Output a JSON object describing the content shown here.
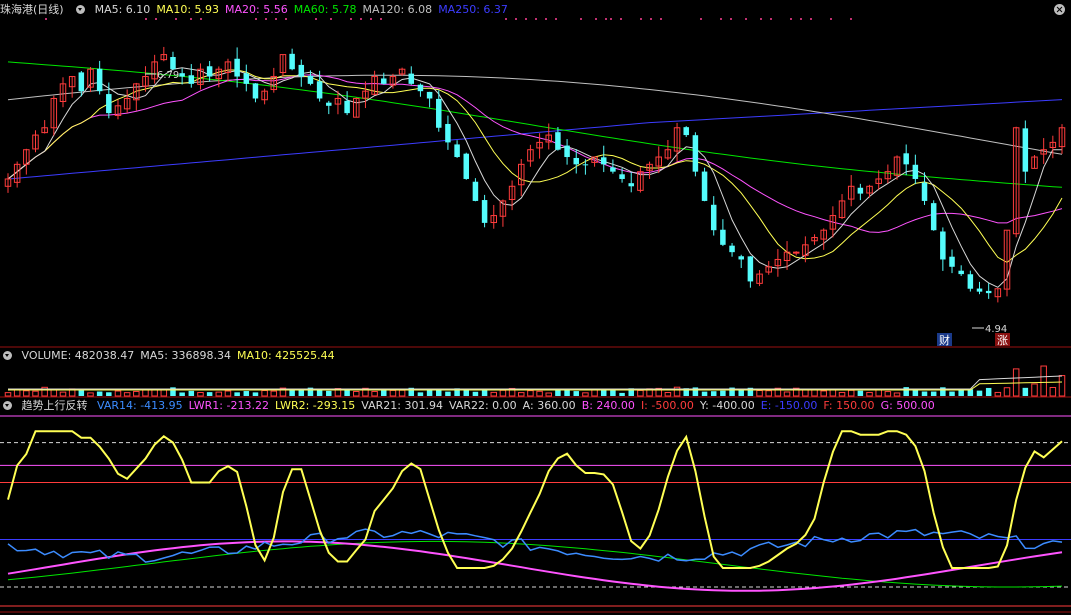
{
  "colors": {
    "bg": "#000000",
    "up": "#ff3c3c",
    "down": "#54fcfc",
    "ma5": "#d8d8d8",
    "ma10": "#ffff54",
    "ma20": "#ff54ff",
    "ma60": "#00e600",
    "ma120": "#c0c0c0",
    "ma250": "#3c3cff",
    "sep": "#9a1010"
  },
  "price_panel": {
    "title": "珠海港(日线)",
    "ma": [
      {
        "label": "MA5: 6.10",
        "color": "#d8d8d8"
      },
      {
        "label": "MA10: 5.93",
        "color": "#ffff54"
      },
      {
        "label": "MA20: 5.56",
        "color": "#ff54ff"
      },
      {
        "label": "MA60: 5.78",
        "color": "#00e600"
      },
      {
        "label": "MA120: 6.08",
        "color": "#c0c0c0"
      },
      {
        "label": "MA250: 6.37",
        "color": "#3c3cff"
      }
    ],
    "high_label": "6.79",
    "low_label": "4.94",
    "badge_cai": "财",
    "badge_zhang": "涨"
  },
  "volume_panel": {
    "items": [
      {
        "label": "VOLUME: 482038.47",
        "color": "#d8d8d8"
      },
      {
        "label": "MA5: 336898.34",
        "color": "#d8d8d8"
      },
      {
        "label": "MA10: 425525.44",
        "color": "#ffff54"
      }
    ]
  },
  "indicator_panel": {
    "title": "趋势上行反转",
    "items": [
      {
        "label": "VAR14: -413.95",
        "color": "#3c8cff"
      },
      {
        "label": "LWR1: -213.22",
        "color": "#ff54ff"
      },
      {
        "label": "LWR2: -293.15",
        "color": "#ffff54"
      },
      {
        "label": "VAR21: 301.94",
        "color": "#d8d8d8"
      },
      {
        "label": "VAR22: 0.00",
        "color": "#d8d8d8"
      },
      {
        "label": "A: 360.00",
        "color": "#d8d8d8"
      },
      {
        "label": "B: 240.00",
        "color": "#ff54ff"
      },
      {
        "label": "I: -500.00",
        "color": "#ff3c3c"
      },
      {
        "label": "Y: -400.00",
        "color": "#d8d8d8"
      },
      {
        "label": "E: -150.00",
        "color": "#3c3cff"
      },
      {
        "label": "F: 150.00",
        "color": "#ff3c3c"
      },
      {
        "label": "G: 500.00",
        "color": "#ff54ff"
      }
    ]
  },
  "chart_data": {
    "type": "candlestick",
    "ylim": [
      4.8,
      6.85
    ],
    "closes": [
      5.75,
      5.85,
      5.95,
      6.05,
      6.1,
      6.3,
      6.4,
      6.45,
      6.35,
      6.5,
      6.35,
      6.2,
      6.25,
      6.3,
      6.4,
      6.45,
      6.55,
      6.6,
      6.5,
      6.45,
      6.4,
      6.5,
      6.45,
      6.5,
      6.55,
      6.45,
      6.4,
      6.3,
      6.35,
      6.45,
      6.6,
      6.5,
      6.45,
      6.4,
      6.3,
      6.25,
      6.3,
      6.2,
      6.3,
      6.35,
      6.45,
      6.4,
      6.45,
      6.5,
      6.4,
      6.35,
      6.3,
      6.1,
      6.0,
      5.9,
      5.75,
      5.6,
      5.45,
      5.5,
      5.6,
      5.7,
      5.85,
      5.95,
      6.0,
      6.05,
      5.95,
      5.9,
      5.85,
      5.85,
      5.9,
      5.85,
      5.8,
      5.75,
      5.7,
      5.8,
      5.85,
      5.9,
      5.95,
      6.1,
      6.05,
      5.8,
      5.6,
      5.4,
      5.3,
      5.25,
      5.2,
      5.05,
      5.1,
      5.15,
      5.2,
      5.25,
      5.25,
      5.3,
      5.35,
      5.4,
      5.5,
      5.6,
      5.7,
      5.65,
      5.7,
      5.75,
      5.8,
      5.9,
      5.85,
      5.75,
      5.6,
      5.4,
      5.2,
      5.15,
      5.1,
      5.0,
      4.98,
      4.97,
      5.0,
      5.4,
      6.1,
      5.8,
      5.9,
      5.95,
      6.0,
      6.1
    ],
    "ma_series": [
      "MA5",
      "MA10",
      "MA20",
      "MA60",
      "MA120",
      "MA250"
    ],
    "volume": {
      "items": [
        "VOLUME",
        "MA5",
        "MA10"
      ]
    },
    "indicator": {
      "series": [
        "VAR14",
        "LWR1",
        "LWR2",
        "VAR21",
        "VAR22"
      ],
      "levels": {
        "A": 360,
        "B": 240,
        "I": -500,
        "Y": -400,
        "E": -150,
        "F": 150,
        "G": 500
      }
    }
  }
}
